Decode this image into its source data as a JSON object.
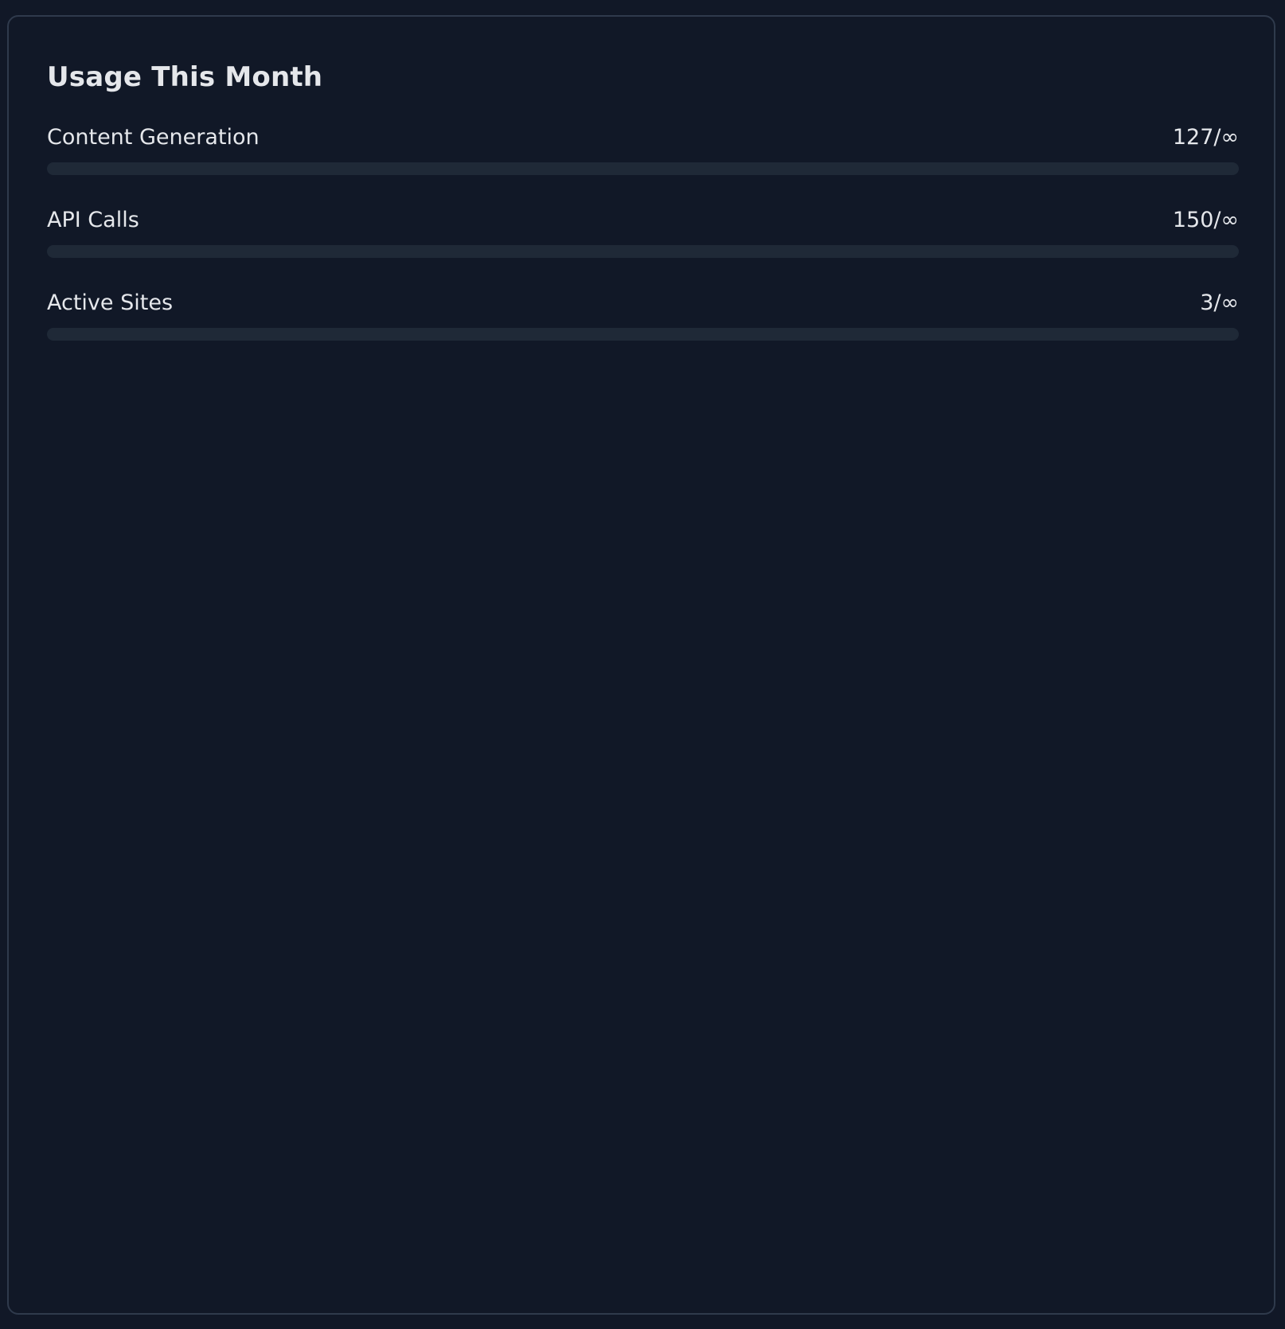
{
  "usage": {
    "title": "Usage This Month",
    "items": [
      {
        "label": "Content Generation",
        "value": "127/∞",
        "fill_fraction": 0
      },
      {
        "label": "API Calls",
        "value": "150/∞",
        "fill_fraction": 0
      },
      {
        "label": "Active Sites",
        "value": "3/∞",
        "fill_fraction": 0
      }
    ]
  },
  "colors": {
    "background": "#111827",
    "card_border": "#2f3a4c",
    "track": "#1f2937",
    "text": "#e5e7eb"
  }
}
